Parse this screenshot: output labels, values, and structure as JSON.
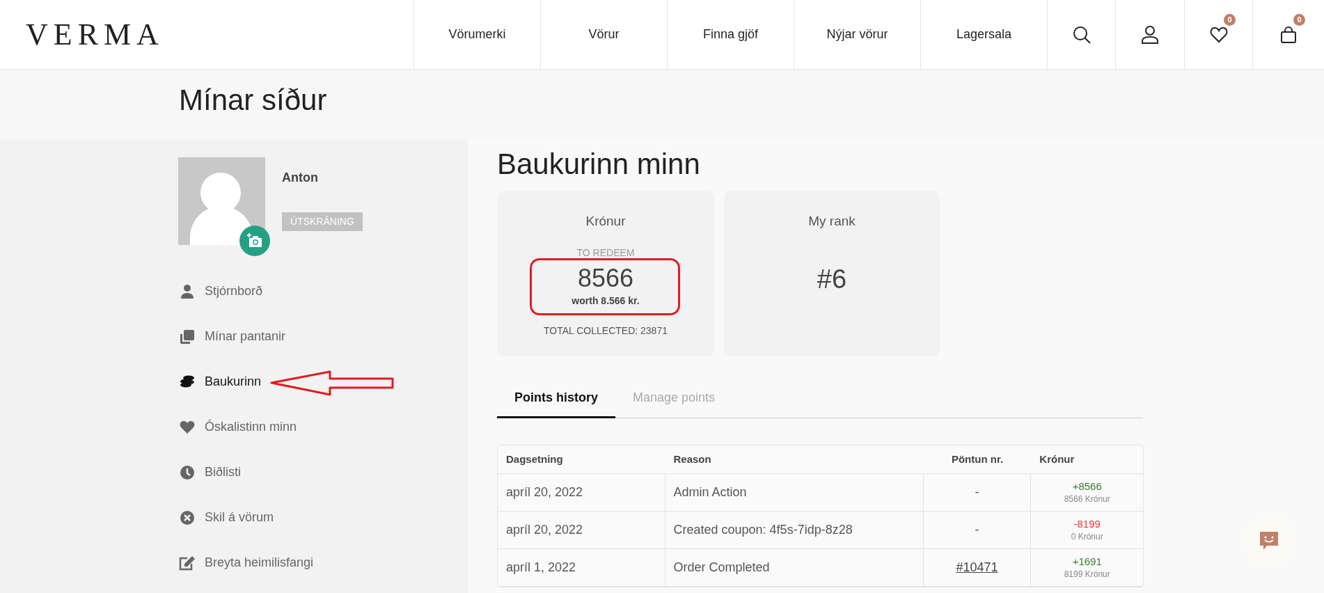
{
  "header": {
    "logo": "VERMA",
    "nav": [
      {
        "label": "Vörumerki"
      },
      {
        "label": "Vörur"
      },
      {
        "label": "Finna gjöf"
      },
      {
        "label": "Nýjar vörur"
      },
      {
        "label": "Lagersala"
      }
    ],
    "wishlist_count": "0",
    "cart_count": "0"
  },
  "page_title": "Mínar síður",
  "profile": {
    "name": "Anton",
    "logout": "ÚTSKRÁNING"
  },
  "sidebar": {
    "items": [
      {
        "kind": "user",
        "label": "Stjórnborð",
        "selected": false
      },
      {
        "kind": "orders",
        "label": "Mínar pantanir",
        "selected": false
      },
      {
        "kind": "coins",
        "label": "Baukurinn",
        "selected": true
      },
      {
        "kind": "heart",
        "label": "Óskalistinn minn",
        "selected": false
      },
      {
        "kind": "clock",
        "label": "Biðlisti",
        "selected": false
      },
      {
        "kind": "cancel",
        "label": "Skil á vörum",
        "selected": false
      },
      {
        "kind": "edit",
        "label": "Breyta heimilisfangi",
        "selected": false
      }
    ]
  },
  "heading": "Baukurinn minn",
  "points_card": {
    "title": "Krónur",
    "label": "TO REDEEM",
    "points": "8566",
    "worth": "worth 8.566 kr.",
    "total": "TOTAL COLLECTED: 23871"
  },
  "rank_card": {
    "title": "My rank",
    "rank": "#6"
  },
  "tabs": [
    {
      "label": "Points history",
      "selected": true
    },
    {
      "label": "Manage points",
      "selected": false
    }
  ],
  "table": {
    "columns": [
      "Dagsetning",
      "Reason",
      "Pöntun nr.",
      "Krónur"
    ],
    "rows": [
      {
        "date": "apríl 20, 2022",
        "reason": "Admin Action",
        "order": "-",
        "order_link": false,
        "change": "+8566",
        "positive": true,
        "balance": "8566 Krónur"
      },
      {
        "date": "apríl 20, 2022",
        "reason": "Created coupon: 4f5s-7idp-8z28",
        "order": "-",
        "order_link": false,
        "change": "-8199",
        "positive": false,
        "balance": "0 Krónur"
      },
      {
        "date": "apríl 1, 2022",
        "reason": "Order Completed",
        "order": "#10471",
        "order_link": true,
        "change": "+1691",
        "positive": true,
        "balance": "8199 Krónur"
      }
    ]
  }
}
